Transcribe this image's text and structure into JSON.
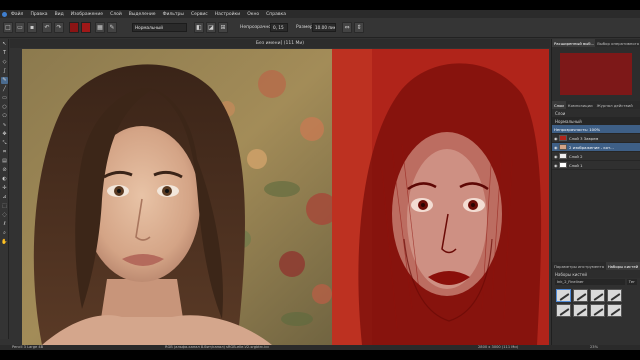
{
  "menu": {
    "items": [
      "Файл",
      "Правка",
      "Вид",
      "Изображение",
      "Слой",
      "Выделение",
      "Фильтры",
      "Сервис",
      "Настройки",
      "Окно",
      "Справка"
    ]
  },
  "toolbar": {
    "blend_mode": "Нормальный",
    "opacity_label": "Непрозрачность:",
    "opacity_value": "0, 15",
    "size_label": "Размер:",
    "size_value": "10.00 пикс.",
    "fg_color": "#8b1414",
    "bg_color": "#a01818"
  },
  "document": {
    "title": "Без имени] (111 Ми)"
  },
  "panels": {
    "top_tabs": [
      "Расширенный выб...",
      "Выбор оперативного"
    ],
    "layers_tabs": [
      "Слои",
      "Композиции",
      "Журнал действий"
    ],
    "layers_title": "Слои",
    "blend_label": "Нормальный",
    "opacity_row": "Непрозрачность: 100%",
    "layers": [
      {
        "name": "Слой 3 Заврем",
        "selected": false
      },
      {
        "name": "2 изображение - кот...",
        "selected": true
      },
      {
        "name": "Слой 2",
        "selected": false
      },
      {
        "name": "Слой 1",
        "selected": false
      }
    ],
    "brush_tabs": [
      "Параметры инструмента",
      "Наборы кистей"
    ],
    "brush_title": "Наборы кистей",
    "brush_filter": "Тег",
    "brush_search": "Ink_2_Fineliner"
  },
  "status": {
    "left": "Pencil 3 Large 4B",
    "center": "RGB (альфа-канал 8-бит/канал)  sRGB-elle-V2-srgbtrc.icc",
    "size": "2800 x 3000 (111 Ми)",
    "zoom": "23%"
  },
  "colors": {
    "accent": "#3e5f86",
    "sketch_red": "#a81a14"
  }
}
